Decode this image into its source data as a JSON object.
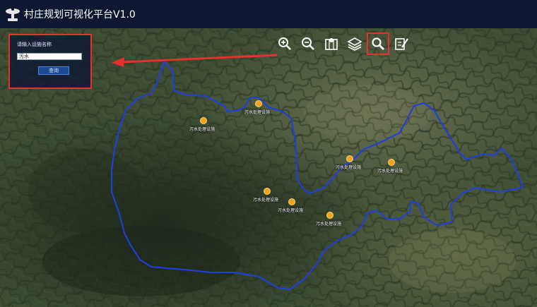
{
  "app": {
    "title": "村庄规划可视化平台V1.0"
  },
  "toolbar": {
    "tools": [
      {
        "name": "zoom-in"
      },
      {
        "name": "zoom-out"
      },
      {
        "name": "map-location"
      },
      {
        "name": "layers"
      },
      {
        "name": "search",
        "active": true
      },
      {
        "name": "edit"
      }
    ]
  },
  "search_panel": {
    "label": "请输入设施名称",
    "input_value": "污水",
    "button_label": "查询"
  },
  "markers": [
    {
      "label": "污水处理设施"
    },
    {
      "label": "污水处理设施"
    },
    {
      "label": "污水处理设施"
    },
    {
      "label": "污水处理设施"
    },
    {
      "label": "污水处理设施"
    },
    {
      "label": "污水处理设施"
    },
    {
      "label": "污水处理设施"
    }
  ],
  "colors": {
    "boundary": "#1f3fe0",
    "marker": "#f0a41b",
    "highlight": "#e8302c",
    "header": "#0e1830"
  }
}
